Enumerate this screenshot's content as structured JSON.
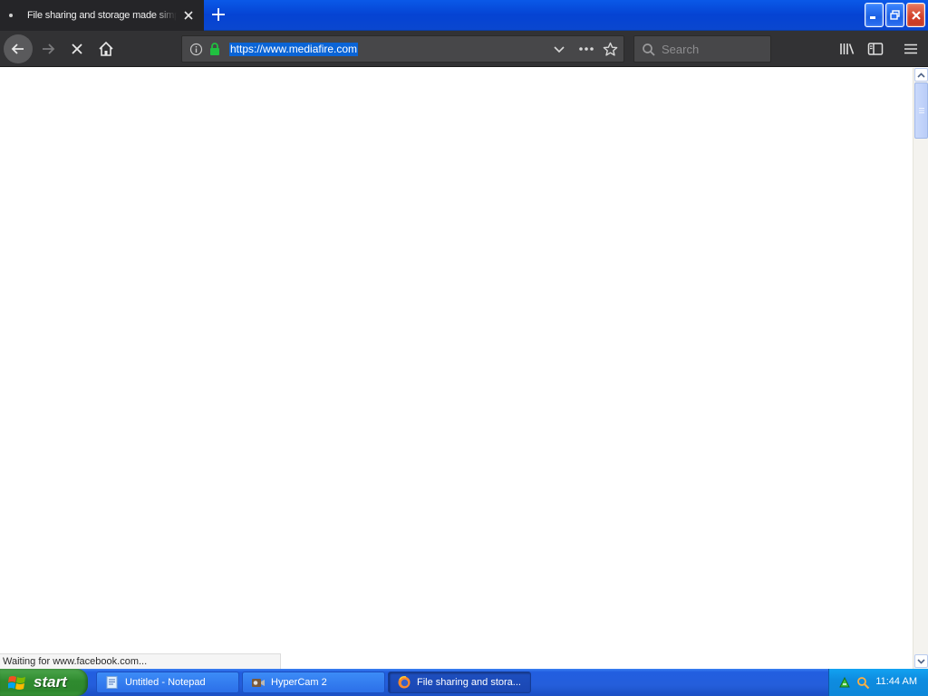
{
  "browser": {
    "tab_title": "File sharing and storage made simple",
    "url": "https://www.mediafire.com",
    "search_placeholder": "Search",
    "status_text": "Waiting for www.facebook.com..."
  },
  "taskbar": {
    "start_label": "start",
    "items": [
      {
        "label": "Untitled - Notepad",
        "icon": "notepad-icon"
      },
      {
        "label": "HyperCam 2",
        "icon": "hypercam-icon"
      },
      {
        "label": "File sharing and stora...",
        "icon": "firefox-icon"
      }
    ],
    "clock": "11:44 AM"
  },
  "colors": {
    "xp_blue": "#0a59e8",
    "toolbar_dark": "#323234",
    "url_selection": "#0a64d6",
    "start_green": "#2f8b2f",
    "close_red": "#d2402a"
  }
}
